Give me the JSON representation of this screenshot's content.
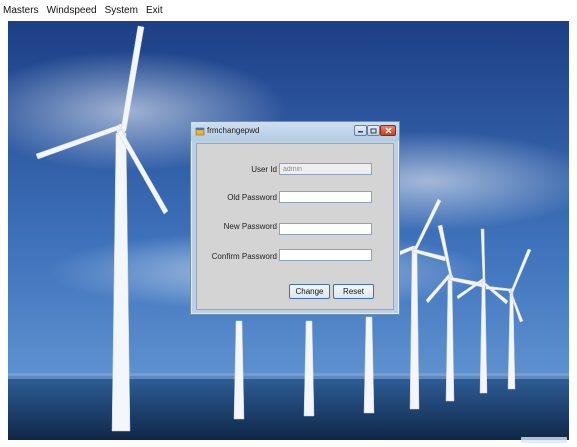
{
  "menu": {
    "items": [
      "Masters",
      "Windspeed",
      "System",
      "Exit"
    ]
  },
  "background": {
    "sky_top": "#1d3f86",
    "sky_bottom": "#4f86c8",
    "sea": "#1b3c6b"
  },
  "dialog": {
    "title": "frmchangepwd",
    "title_icon": "form-icon",
    "fields": {
      "user_id": {
        "label": "User Id",
        "value": "admin",
        "enabled": false
      },
      "old_password": {
        "label": "Old Password",
        "value": ""
      },
      "new_password": {
        "label": "New Password",
        "value": ""
      },
      "confirm_password": {
        "label": "Confirm Password",
        "value": ""
      }
    },
    "buttons": {
      "change": "Change",
      "reset": "Reset"
    }
  }
}
